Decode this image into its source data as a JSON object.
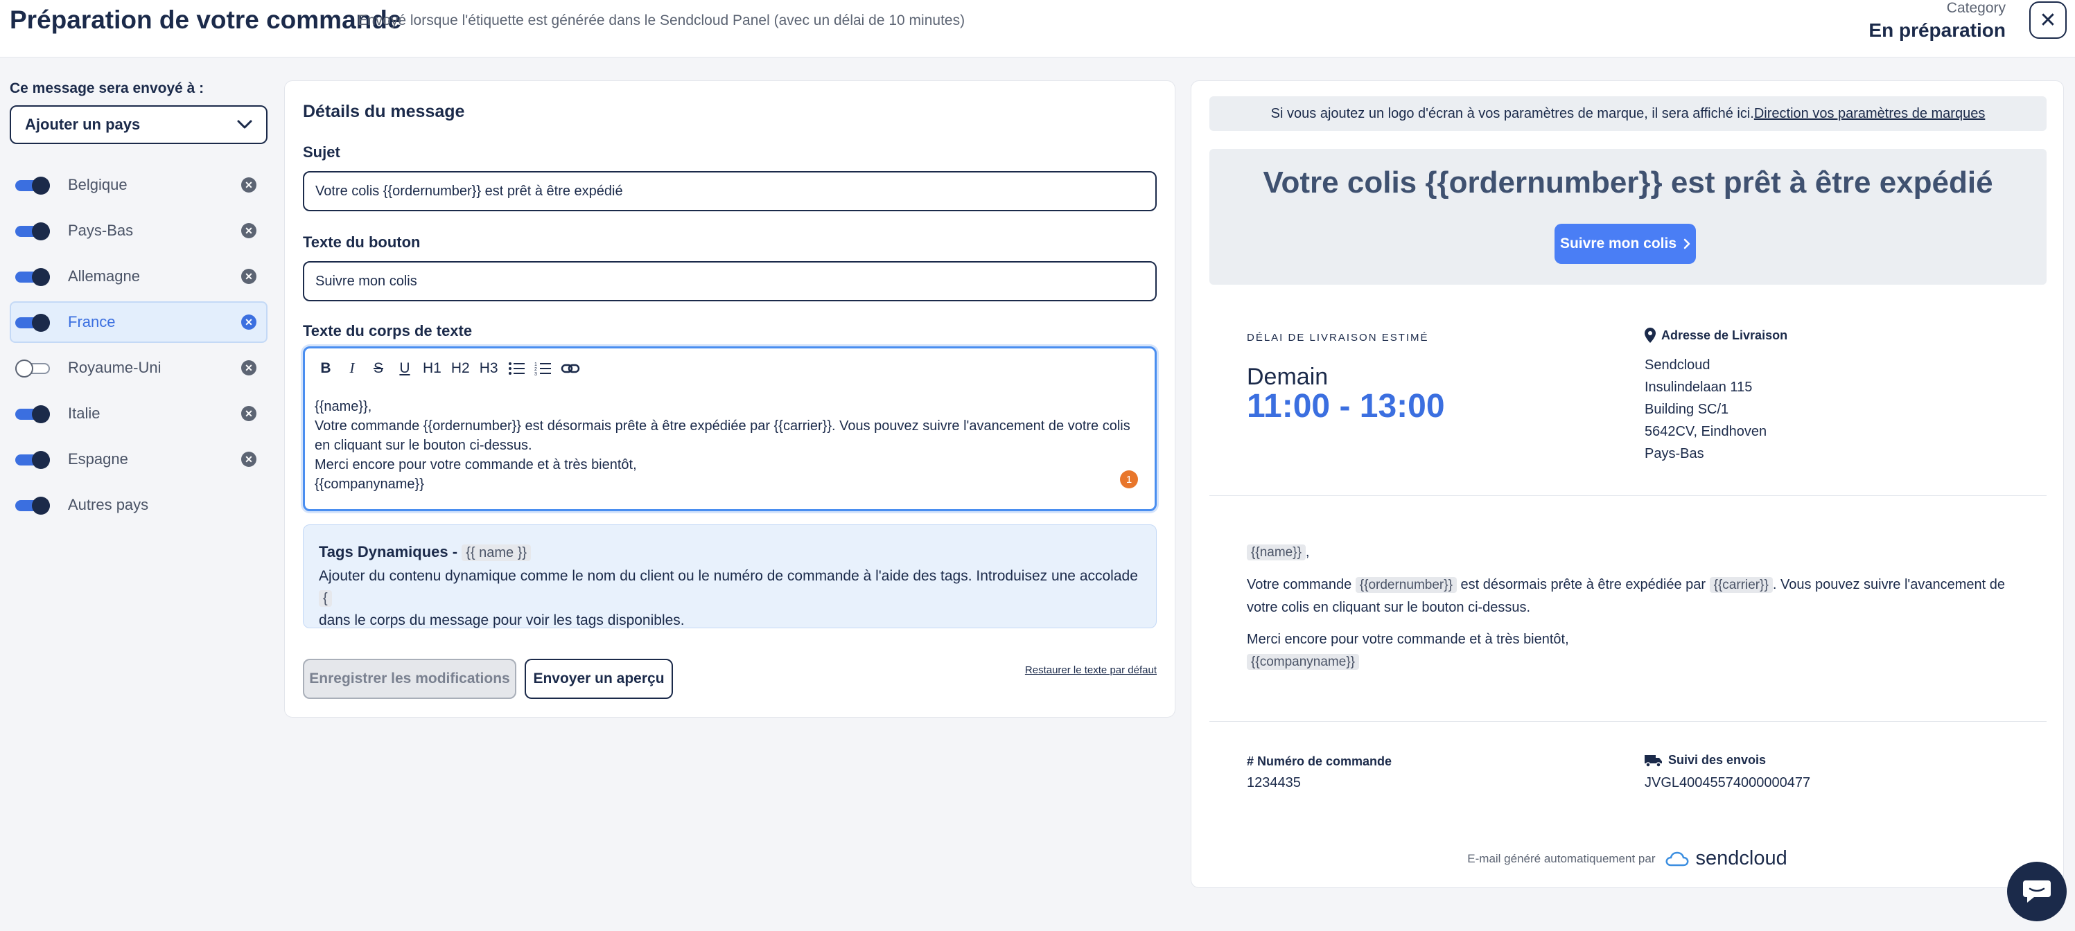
{
  "header": {
    "title": "Préparation de votre commande",
    "subtitle": "Envoyé lorsque l'étiquette est générée dans le Sendcloud Panel (avec un délai de 10 minutes)",
    "category_label": "Category",
    "category_value": "En préparation",
    "close_glyph": "✕"
  },
  "recipients": {
    "label": "Ce message sera envoyé à :",
    "select_value": "Ajouter un pays",
    "countries": [
      {
        "name": "Belgique",
        "enabled": true
      },
      {
        "name": "Pays-Bas",
        "enabled": true
      },
      {
        "name": "Allemagne",
        "enabled": true
      },
      {
        "name": "France",
        "enabled": true,
        "selected": true
      },
      {
        "name": "Royaume-Uni",
        "enabled": false
      },
      {
        "name": "Italie",
        "enabled": true
      },
      {
        "name": "Espagne",
        "enabled": true
      },
      {
        "name": "Autres pays",
        "enabled": true
      }
    ]
  },
  "form": {
    "title": "Détails du message",
    "subject_label": "Sujet",
    "subject_value": "Votre colis {{ordernumber}} est prêt à être expédié",
    "button_text_label": "Texte du bouton",
    "button_text_value": "Suivre mon colis",
    "body_label": "Texte du corps de texte",
    "toolbar": [
      "B",
      "I",
      "S",
      "U",
      "H1",
      "H2",
      "H3",
      "bullet-list",
      "numbered-list",
      "link"
    ],
    "body_lines": [
      "{{name}},",
      "Votre commande {{ordernumber}} est désormais prête à être expédiée par {{carrier}}. Vous pouvez suivre l'avancement de votre colis en cliquant sur le bouton ci-dessus.",
      "Merci encore pour votre commande et à très bientôt,",
      "{{companyname}}"
    ],
    "badge_count": "1",
    "tags_title": "Tags Dynamiques -",
    "tags_chip": "{{ name }}",
    "tags_desc": "Ajouter du contenu dynamique comme le nom du client ou le numéro de commande à l'aide des tags. Introduisez une accolade",
    "tags_brace": "{",
    "tags_desc_end": "dans le corps du message pour voir les tags disponibles.",
    "save_label": "Enregistrer les modifications",
    "preview_label": "Envoyer un aperçu",
    "restore_label": "Restaurer le texte par défaut"
  },
  "preview": {
    "logo_note": "Si vous ajoutez un logo d'écran à vos paramètres de marque, il sera affiché ici.",
    "logo_link": "Direction vos paramètres de marques",
    "hero_title": "Votre colis {{ordernumber}} est prêt à être expédié",
    "hero_button": "Suivre mon colis",
    "est_label": "DÉLAI DE LIVRAISON ESTIMÉ",
    "est_day": "Demain",
    "est_time": "11:00 - 13:00",
    "address_title": "Adresse de Livraison",
    "address_lines": [
      "Sendcloud",
      "Insulindelaan 115",
      "Building SC/1",
      "5642CV, Eindhoven",
      "Pays-Bas"
    ],
    "greeting_tag": "{{name}}",
    "greeting_suffix": ",",
    "body_pre": "Votre commande",
    "tag_ordernumber": "{{ordernumber}}",
    "body_mid": "est désormais prête à être expédiée par",
    "tag_carrier": "{{carrier}}",
    "body_post": ". Vous pouvez suivre l'avancement de votre colis en cliquant sur le bouton ci-dessus.",
    "thanks": "Merci encore pour votre commande et à très bientôt,",
    "tag_company": "{{companyname}}",
    "order_title": "# Numéro de commande",
    "order_value": "1234435",
    "tracking_title": "Suivi des envois",
    "tracking_value": "JVGL40045574000000477",
    "footer_text": "E-mail généré automatiquement par",
    "footer_brand": "sendcloud"
  },
  "colors": {
    "navy": "#1b2a4a",
    "accent_blue": "#3b6fe0",
    "button_blue": "#4a7ef5",
    "badge_orange": "#e8762b"
  }
}
